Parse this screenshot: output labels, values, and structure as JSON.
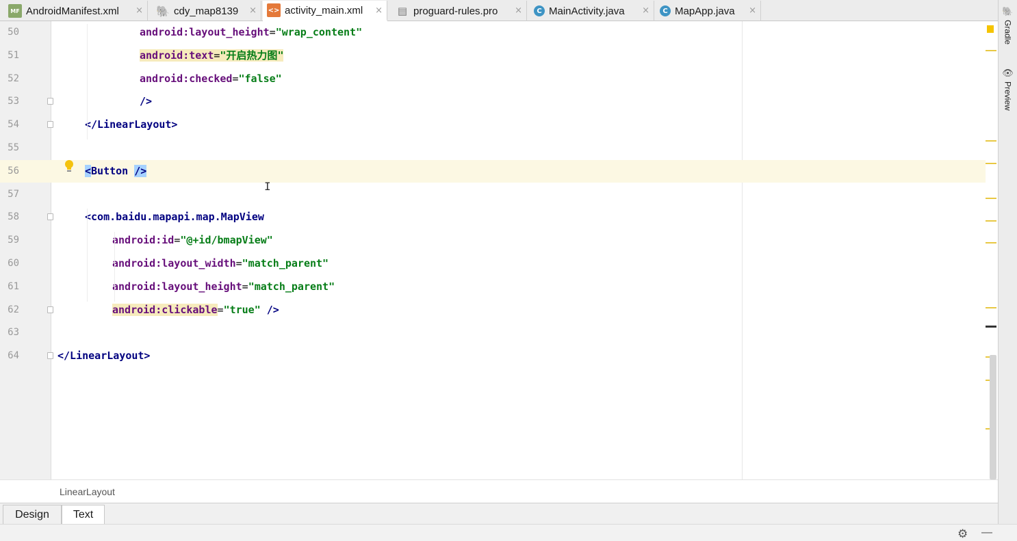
{
  "tabs": [
    {
      "label": "AndroidManifest.xml",
      "icon": "manifest-icon",
      "active": false
    },
    {
      "label": "cdy_map8139",
      "icon": "gradle-icon",
      "active": false
    },
    {
      "label": "activity_main.xml",
      "icon": "xml-layout-icon",
      "active": true
    },
    {
      "label": "proguard-rules.pro",
      "icon": "text-file-icon",
      "active": false
    },
    {
      "label": "MainActivity.java",
      "icon": "java-class-icon",
      "active": false
    },
    {
      "label": "MapApp.java",
      "icon": "java-class-icon",
      "active": false
    }
  ],
  "tab_icon_glyphs": {
    "manifest": "MF",
    "gradle": "🐘",
    "xml": "<>",
    "file": "▤",
    "class": "C"
  },
  "close_glyph": "×",
  "editor": {
    "lines": [
      {
        "num": "50",
        "indent": "            ",
        "parts": [
          {
            "t": "android:layout_height",
            "c": "attr"
          },
          {
            "t": "=",
            "c": "plain"
          },
          {
            "t": "\"wrap_content\"",
            "c": "val"
          }
        ]
      },
      {
        "num": "51",
        "indent": "            ",
        "parts": [
          {
            "t": "android:text",
            "c": "attr hl-warn"
          },
          {
            "t": "=",
            "c": "plain hl-warn"
          },
          {
            "t": "\"开启热力图\"",
            "c": "val hl-warn"
          }
        ]
      },
      {
        "num": "52",
        "indent": "            ",
        "parts": [
          {
            "t": "android:checked",
            "c": "attr"
          },
          {
            "t": "=",
            "c": "plain"
          },
          {
            "t": "\"false\"",
            "c": "val"
          }
        ]
      },
      {
        "num": "53",
        "indent": "            ",
        "parts": [
          {
            "t": "/>",
            "c": "tag"
          }
        ]
      },
      {
        "num": "54",
        "indent": "    ",
        "parts": [
          {
            "t": "</LinearLayout>",
            "c": "tag"
          }
        ]
      },
      {
        "num": "55",
        "indent": "",
        "parts": []
      },
      {
        "num": "56",
        "indent": "    ",
        "parts": [
          {
            "t": "<",
            "c": "tag hl-sel"
          },
          {
            "t": "Button ",
            "c": "tag"
          },
          {
            "t": "/>",
            "c": "tag hl-sel"
          }
        ]
      },
      {
        "num": "57",
        "indent": "",
        "parts": []
      },
      {
        "num": "58",
        "indent": "    ",
        "parts": [
          {
            "t": "<com.baidu.mapapi.map.MapView",
            "c": "tag"
          }
        ]
      },
      {
        "num": "59",
        "indent": "        ",
        "parts": [
          {
            "t": "android:id",
            "c": "attr"
          },
          {
            "t": "=",
            "c": "plain"
          },
          {
            "t": "\"@+id/bmapView\"",
            "c": "val"
          }
        ]
      },
      {
        "num": "60",
        "indent": "        ",
        "parts": [
          {
            "t": "android:layout_width",
            "c": "attr"
          },
          {
            "t": "=",
            "c": "plain"
          },
          {
            "t": "\"match_parent\"",
            "c": "val"
          }
        ]
      },
      {
        "num": "61",
        "indent": "        ",
        "parts": [
          {
            "t": "android:layout_height",
            "c": "attr"
          },
          {
            "t": "=",
            "c": "plain"
          },
          {
            "t": "\"match_parent\"",
            "c": "val"
          }
        ]
      },
      {
        "num": "62",
        "indent": "        ",
        "parts": [
          {
            "t": "android:clickable",
            "c": "attr hl-warn"
          },
          {
            "t": "=",
            "c": "plain"
          },
          {
            "t": "\"true\"",
            "c": "val"
          },
          {
            "t": " />",
            "c": "tag"
          }
        ]
      },
      {
        "num": "63",
        "indent": "",
        "parts": []
      },
      {
        "num": "64",
        "indent": "",
        "parts": [
          {
            "t": "</LinearLayout>",
            "c": "tag"
          }
        ]
      }
    ],
    "fold_lines": [
      "53",
      "54",
      "58",
      "62",
      "64"
    ],
    "caret_line": "56",
    "text_cursor_glyph": "I"
  },
  "breadcrumb": "LinearLayout",
  "bottom_tabs": [
    {
      "label": "Design",
      "active": false
    },
    {
      "label": "Text",
      "active": true
    }
  ],
  "tool_window": {
    "gradle_label": "Gradle",
    "preview_label": "Preview",
    "gradle_glyph": "🐘",
    "preview_glyph": "👁"
  },
  "status": {
    "gear_glyph": "⚙",
    "dash_glyph": "—"
  },
  "colors": {
    "tag": "#000080",
    "attribute": "#660e7a",
    "value": "#067d17",
    "warning_highlight": "#f6ebbc",
    "selection_highlight": "#a6d2ff",
    "caret_line": "#fcf8e3",
    "marker": "#e8c843"
  }
}
